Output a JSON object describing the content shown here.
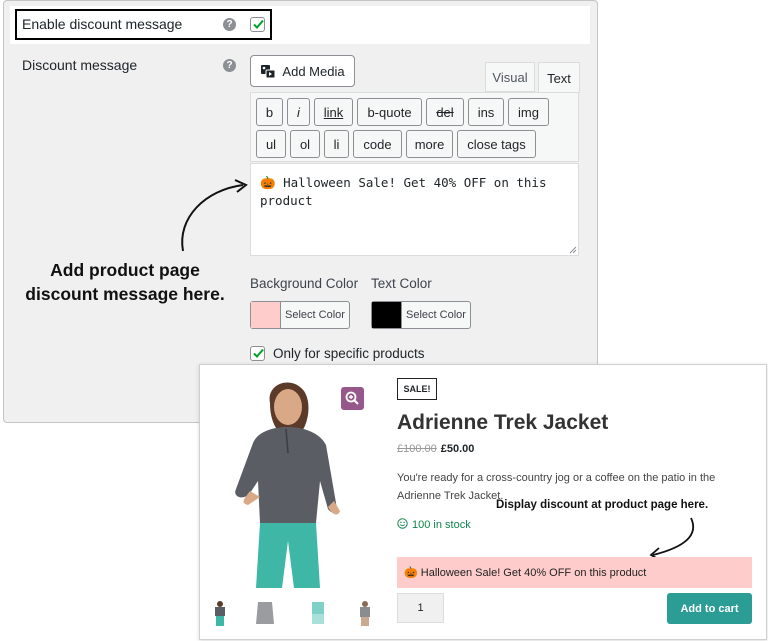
{
  "settings": {
    "enable_label": "Enable discount message",
    "enable_help": "?",
    "message_label": "Discount message",
    "message_help": "?",
    "add_media": "Add Media",
    "tabs": [
      "Visual",
      "Text"
    ],
    "toolbar_row1": [
      "b",
      "i",
      "link",
      "b-quote",
      "del",
      "ins",
      "img"
    ],
    "toolbar_row2": [
      "ul",
      "ol",
      "li",
      "code",
      "more",
      "close tags"
    ],
    "editor_text": "🎃 Halloween Sale! Get 40% OFF on this product",
    "bg_color_label": "Background Color",
    "text_color_label": "Text Color",
    "select_color": "Select Color",
    "bg_color": "#ffcccc",
    "text_color": "#000000",
    "specific_label": "Only for specific products"
  },
  "callouts": {
    "admin_line1": "Add product page",
    "admin_line2": "discount message here.",
    "product": "Display discount at product page here."
  },
  "product": {
    "badge": "SALE!",
    "title": "Adrienne Trek Jacket",
    "old_price": "£100.00",
    "new_price": "£50.00",
    "description": "You're ready for a cross-country jog or a coffee on the patio in the Adrienne Trek Jacket.",
    "stock": "100 in stock",
    "discount_message": "🎃 Halloween Sale! Get 40% OFF on this product",
    "quantity": "1",
    "add_to_cart": "Add to cart"
  },
  "colors": {
    "accent": "#2b9d95",
    "zoom_button": "#96588a",
    "checkbox": "#00a32a"
  }
}
